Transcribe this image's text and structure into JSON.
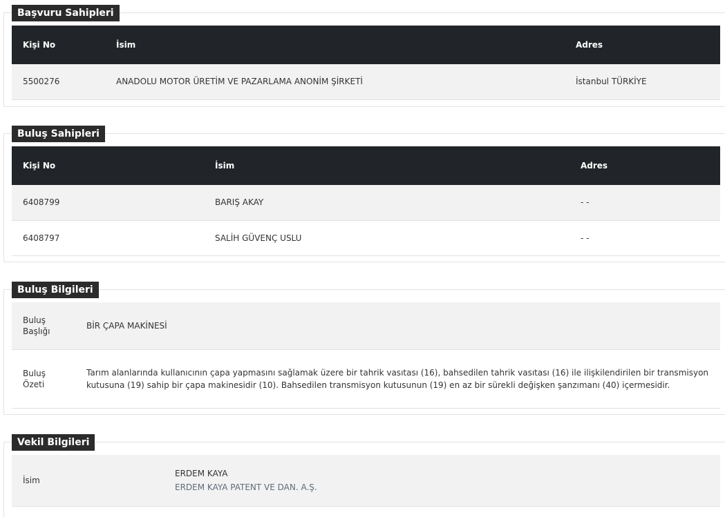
{
  "applicants": {
    "title": "Başvuru Sahipleri",
    "columns": [
      "Kişi No",
      "İsim",
      "Adres"
    ],
    "rows": [
      [
        "5500276",
        "ANADOLU MOTOR ÜRETİM VE PAZARLAMA ANONİM ŞİRKETİ",
        "İstanbul TÜRKİYE"
      ]
    ]
  },
  "inventors": {
    "title": "Buluş Sahipleri",
    "columns": [
      "Kişi No",
      "İsim",
      "Adres"
    ],
    "rows": [
      [
        "6408799",
        "BARIŞ AKAY",
        "- -"
      ],
      [
        "6408797",
        "SALİH GÜVENÇ USLU",
        "- -"
      ]
    ]
  },
  "invention": {
    "title": "Buluş Bilgileri",
    "title_label": "Buluş Başlığı",
    "title_value": "BİR ÇAPA MAKİNESİ",
    "summary_label": "Buluş Özeti",
    "summary_value": "Tarım alanlarında kullanıcının çapa yapmasını sağlamak üzere bir tahrik vasıtası (16), bahsedilen tahrik vasıtası (16) ile ilişkilendirilen bir transmisyon kutusuna (19) sahip bir çapa makinesidir (10). Bahsedilen transmisyon kutusunun (19) en az bir sürekli değişken şanzımanı (40) içermesidir."
  },
  "attorney": {
    "title": "Vekil Bilgileri",
    "name_label": "İsim",
    "name_value": "ERDEM KAYA",
    "firm_value": "ERDEM KAYA PATENT VE DAN. A.Ş."
  }
}
